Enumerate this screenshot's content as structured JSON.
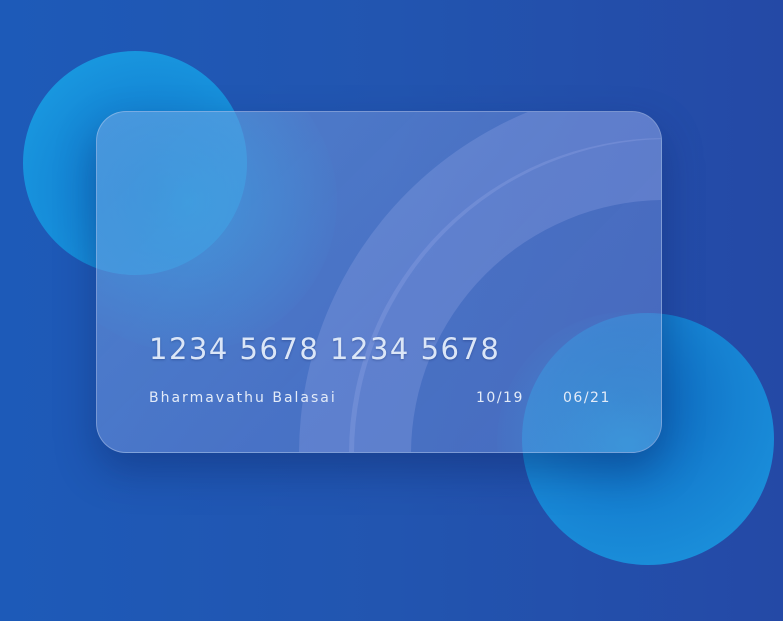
{
  "card": {
    "number": "1234 5678 1234 5678",
    "holder_name": "Bharmavathu Balasai",
    "valid_from": "10/19",
    "valid_thru": "06/21"
  },
  "colors": {
    "background": "#2255b0",
    "circle": "#1a8fdc",
    "card_text": "#e3ebf8"
  }
}
